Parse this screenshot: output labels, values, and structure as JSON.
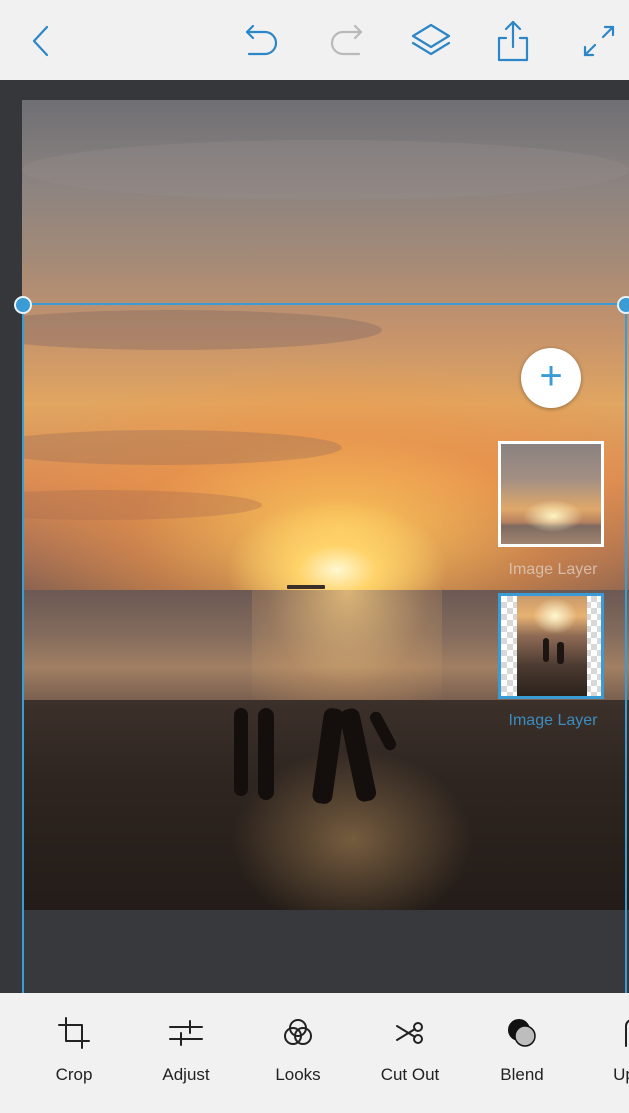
{
  "toolbar": {
    "back": "back-icon",
    "undo": "undo-icon",
    "redo": "redo-icon",
    "layers": "layers-icon",
    "share": "share-icon",
    "expand": "expand-icon",
    "accent_color": "#2c86c7"
  },
  "layers_panel": {
    "add_icon": "+",
    "layers": [
      {
        "label": "Image Layer",
        "selected": false
      },
      {
        "label": "Image Layer",
        "selected": true
      }
    ],
    "selection_color": "#3b9bd4"
  },
  "tools": [
    {
      "label": "Crop",
      "icon": "crop-icon"
    },
    {
      "label": "Adjust",
      "icon": "adjust-icon"
    },
    {
      "label": "Looks",
      "icon": "looks-icon"
    },
    {
      "label": "Cut Out",
      "icon": "cut-out-icon"
    },
    {
      "label": "Blend",
      "icon": "blend-icon"
    },
    {
      "label": "Up",
      "icon": "upright-icon"
    }
  ]
}
